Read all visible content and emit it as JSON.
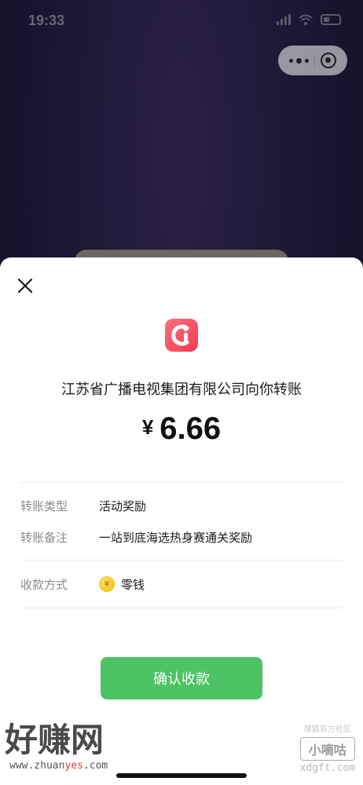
{
  "status_bar": {
    "time": "19:33"
  },
  "capsule": {
    "more_icon": "dots-icon",
    "close_icon": "target-icon"
  },
  "transfer": {
    "payer_text": "江苏省广播电视集团有限公司向你转账",
    "currency": "¥",
    "amount": "6.66",
    "details": [
      {
        "label": "转账类型",
        "value": "活动奖励"
      },
      {
        "label": "转账备注",
        "value": "一站到底海选热身赛通关奖励"
      }
    ],
    "receive": {
      "label": "收款方式",
      "value": "零钱",
      "icon": "coin-icon",
      "coin_symbol": "¥"
    },
    "confirm_label": "确认收款"
  },
  "watermarks": {
    "left_big": "好赚网",
    "left_url_prefix": "www.zhuan",
    "left_url_highlight": "yes",
    "left_url_suffix": ".com",
    "right_small": "搜狐官方社区",
    "right_box": "小嘀咕",
    "right_domain": "xdgft.com"
  },
  "colors": {
    "confirm_green": "#4cc463",
    "logo_red": "#f23a54"
  }
}
